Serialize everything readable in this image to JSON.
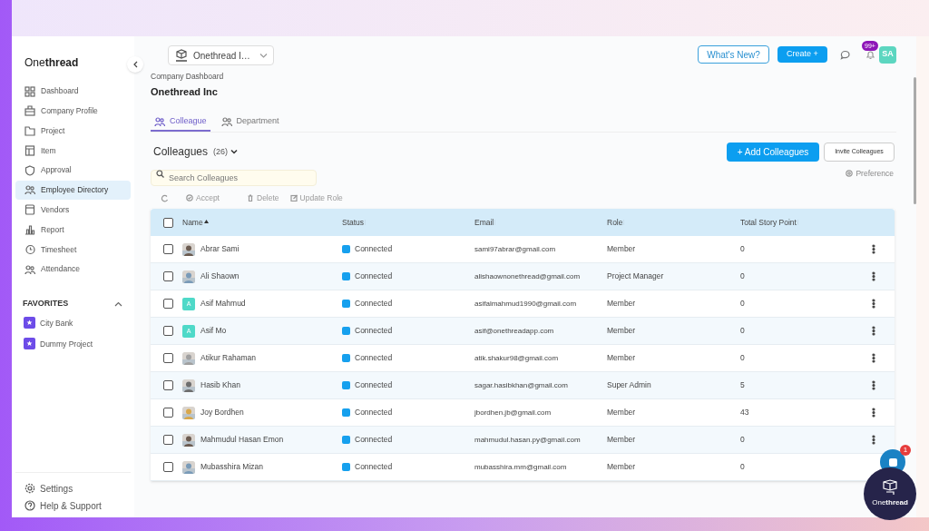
{
  "sidebar": {
    "logo": "One**thread**",
    "items": [
      {
        "label": "Dashboard",
        "selected": false
      },
      {
        "label": "Company Profile",
        "selected": false
      },
      {
        "label": "Project",
        "selected": false
      },
      {
        "label": "Item",
        "selected": false
      },
      {
        "label": "Approval",
        "selected": false
      },
      {
        "label": "Employee Directory",
        "selected": true
      },
      {
        "label": "Vendors",
        "selected": false
      },
      {
        "label": "Report",
        "selected": false
      },
      {
        "label": "Timesheet",
        "selected": false
      },
      {
        "label": "Attendance",
        "selected": false
      }
    ],
    "favorites": {
      "title": "FAVORITES",
      "expanded": true,
      "items": [
        "City Bank",
        "Dummy Project"
      ]
    },
    "footer": [
      "Settings",
      "Help & Support"
    ]
  },
  "topbar": {
    "company": "Onethread I…",
    "whats_new": "What's New?",
    "create": "Create +",
    "notifications_badge": "99+",
    "user_initials": "SA"
  },
  "breadcrumb": "Company Dashboard",
  "page_title": "Onethread Inc",
  "tabs": [
    {
      "label": "Colleague",
      "selected": true
    },
    {
      "label": "Department",
      "selected": false
    }
  ],
  "list_header": {
    "title": "Colleagues",
    "count": "(26)",
    "add_button": "+ Add Colleagues",
    "invite_button": "Invite Colleagues",
    "preference": "Preference"
  },
  "search": {
    "placeholder": "Search Colleagues"
  },
  "actions": [
    "Accept",
    "Delete",
    "Update Role"
  ],
  "table": {
    "all_checked": false,
    "columns": [
      "Name",
      "Status",
      "Email",
      "Role",
      "Total Story Point"
    ],
    "rows": [
      {
        "name": "Abrar Sami",
        "kind": "picture",
        "status": "Connected",
        "email": "sami97abrar@gmail.com",
        "role": "Member",
        "points": "0",
        "checked": false
      },
      {
        "name": "Ali Shaown",
        "kind": "picture",
        "status": "Connected",
        "email": "alishaownonethread@gmail.com",
        "role": "Project Manager",
        "points": "0",
        "checked": false
      },
      {
        "name": "Asif Mahmud",
        "kind": "letter",
        "initial": "A",
        "status": "Connected",
        "email": "asifalmahmud1990@gmail.com",
        "role": "Member",
        "points": "0",
        "checked": false
      },
      {
        "name": "Asif Mo",
        "kind": "letter",
        "initial": "A",
        "status": "Connected",
        "email": "asif@onethreadapp.com",
        "role": "Member",
        "points": "0",
        "checked": false
      },
      {
        "name": "Atikur Rahaman",
        "kind": "picture",
        "status": "Connected",
        "email": "atik.shakur98@gmail.com",
        "role": "Member",
        "points": "0",
        "checked": false
      },
      {
        "name": "Hasib Khan",
        "kind": "picture",
        "status": "Connected",
        "email": "sagar.hasibkhan@gmail.com",
        "role": "Super Admin",
        "points": "5",
        "checked": false
      },
      {
        "name": "Joy Bordhen",
        "kind": "picture",
        "status": "Connected",
        "email": "jbordhen.jb@gmail.com",
        "role": "Member",
        "points": "43",
        "checked": false
      },
      {
        "name": "Mahmudul Hasan Emon",
        "kind": "picture",
        "status": "Connected",
        "email": "mahmudul.hasan.py@gmail.com",
        "role": "Member",
        "points": "0",
        "checked": false
      },
      {
        "name": "Mubasshira Mizan",
        "kind": "picture",
        "status": "Connected",
        "email": "mubasshira.mm@gmail.com",
        "role": "Member",
        "points": "0",
        "checked": false
      }
    ]
  },
  "chat_widget": {
    "badge": "1",
    "brand": "One**thread**"
  }
}
